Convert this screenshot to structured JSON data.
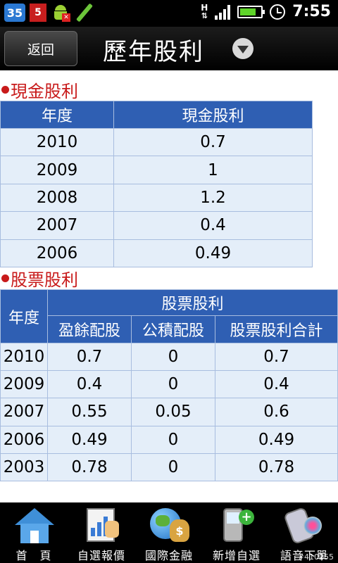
{
  "status_bar": {
    "badge_number": "35",
    "badge_five": "5",
    "network_label": "H",
    "time": "7:55"
  },
  "header": {
    "back_label": "返回",
    "title": "歷年股利"
  },
  "cash_dividend": {
    "section_title": "現金股利",
    "columns": [
      "年度",
      "現金股利"
    ],
    "rows": [
      [
        "2010",
        "0.7"
      ],
      [
        "2009",
        "1"
      ],
      [
        "2008",
        "1.2"
      ],
      [
        "2007",
        "0.4"
      ],
      [
        "2006",
        "0.49"
      ]
    ]
  },
  "stock_dividend": {
    "section_title": "股票股利",
    "year_header": "年度",
    "group_header": "股票股利",
    "sub_columns": [
      "盈餘配股",
      "公積配股",
      "股票股利合計"
    ],
    "rows": [
      [
        "2010",
        "0.7",
        "0",
        "0.7"
      ],
      [
        "2009",
        "0.4",
        "0",
        "0.4"
      ],
      [
        "2007",
        "0.55",
        "0.05",
        "0.6"
      ],
      [
        "2006",
        "0.49",
        "0",
        "0.49"
      ],
      [
        "2003",
        "0.78",
        "0",
        "0.78"
      ]
    ]
  },
  "bottom_nav": {
    "items": [
      {
        "label": "首　頁",
        "icon": "home-icon"
      },
      {
        "label": "自選報價",
        "icon": "watchlist-quote-icon"
      },
      {
        "label": "國際金融",
        "icon": "global-finance-icon"
      },
      {
        "label": "新增自選",
        "icon": "add-watchlist-icon"
      },
      {
        "label": "語音下單",
        "icon": "voice-order-icon"
      }
    ],
    "watermark": "#410255"
  }
}
